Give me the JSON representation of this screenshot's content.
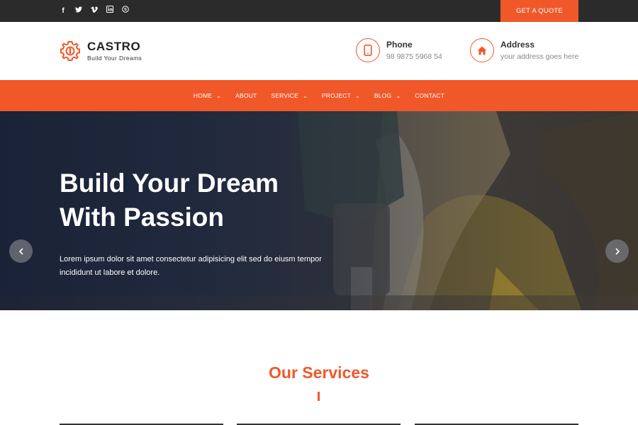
{
  "topbar": {
    "social": [
      {
        "icon": "facebook-icon",
        "glyph": "f"
      },
      {
        "icon": "twitter-icon",
        "glyph": "🐦"
      },
      {
        "icon": "vimeo-icon",
        "glyph": "v"
      },
      {
        "icon": "linkedin-icon",
        "glyph": "in"
      },
      {
        "icon": "skype-icon",
        "glyph": "S"
      }
    ],
    "quote_label": "GET A QUOTE"
  },
  "brand": {
    "name": "CASTRO",
    "tagline": "Build Your Dreams"
  },
  "contact": {
    "phone_title": "Phone",
    "phone_value": "98 9875 5968 54",
    "address_title": "Address",
    "address_value": "your address goes here"
  },
  "nav": {
    "items": [
      {
        "label": "HOME",
        "dropdown": true
      },
      {
        "label": "ABOUT",
        "dropdown": false
      },
      {
        "label": "SERVICE",
        "dropdown": true
      },
      {
        "label": "PROJECT",
        "dropdown": true
      },
      {
        "label": "BLOG",
        "dropdown": true
      },
      {
        "label": "CONTACT",
        "dropdown": false
      }
    ]
  },
  "hero": {
    "title_line1": "Build Your Dream",
    "title_line2": "With Passion",
    "text_line1": "Lorem ipsum dolor sit amet consectetur adipisicing elit sed do eiusm tempor",
    "text_line2": "incididunt ut labore et dolore."
  },
  "services": {
    "title": "Our Services"
  },
  "colors": {
    "accent": "#f0582a",
    "topbar": "#2b2b2b"
  }
}
